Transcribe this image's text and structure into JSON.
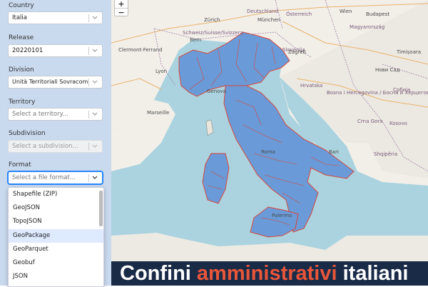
{
  "sidebar": {
    "country": {
      "label": "Country",
      "value": "Italia"
    },
    "release": {
      "label": "Release",
      "value": "20220101"
    },
    "division": {
      "label": "Division",
      "value": "Unità Territoriali Sovracomunali"
    },
    "territory": {
      "label": "Territory",
      "placeholder": "Select a territory..."
    },
    "subdivision": {
      "label": "Subdivision",
      "placeholder": "Select a subdivision..."
    },
    "format": {
      "label": "Format",
      "placeholder": "Select a file format...",
      "options": [
        "Shapefile (ZIP)",
        "GeoJSON",
        "TopoJSON",
        "GeoPackage",
        "GeoParquet",
        "Geobuf",
        "JSON"
      ],
      "highlighted": "GeoPackage"
    }
  },
  "map": {
    "zoom_in": "+",
    "zoom_out": "−",
    "labels": {
      "germany": "Deutschland",
      "osterreich": "Österreich",
      "schweiz": "Schweiz/Suisse/Svizzera",
      "magyarorszag": "Magyarország",
      "slovenija": "Slovenija",
      "hrvatska": "Hrvatska",
      "bosnia": "Bosna i Hercegovina / Босна и Херцеговина",
      "srbija": "Србија",
      "crna_gora": "Crna Gora",
      "kosovo": "Kosovo",
      "shqiperia": "Shqipëria",
      "zurich": "Zürich",
      "munchen": "München",
      "wien": "Wien",
      "budapest": "Budapest",
      "bern": "Bern",
      "lyon": "Lyon",
      "marseille": "Marseille",
      "zagreb": "Zagreb",
      "genova": "Genova",
      "roma": "Roma",
      "bari": "Bari",
      "palermo": "Palermo",
      "timisoara": "Timișoara",
      "clermont": "Clermont-Ferrand",
      "novi_sad": "Нови Сад"
    },
    "colors": {
      "region_fill": "#6a9bd8",
      "region_border": "#d9463a",
      "sea": "#aad3df",
      "land": "#f2efe9"
    }
  },
  "banner": {
    "word1": "Confini ",
    "word2": "amministrativi",
    "word3": " italiani"
  }
}
